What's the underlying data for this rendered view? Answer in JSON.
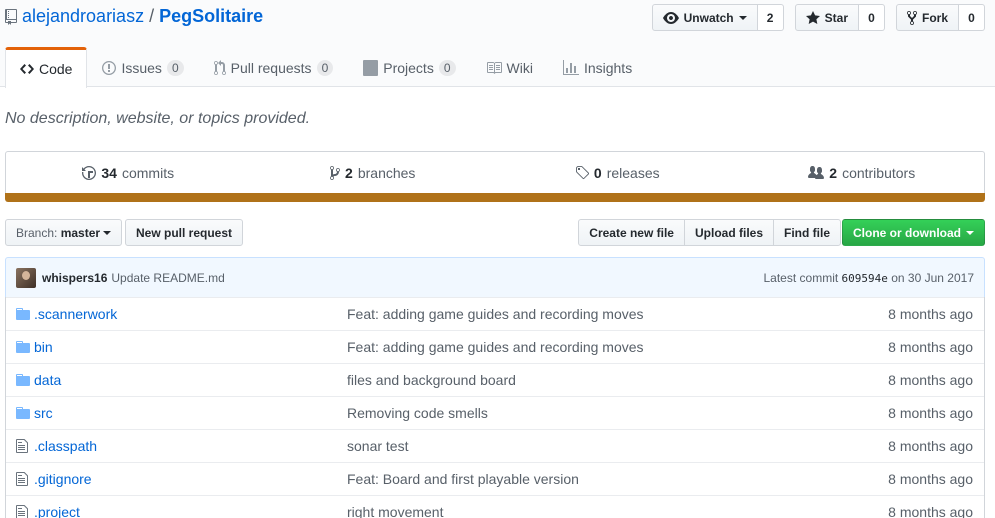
{
  "repo": {
    "owner": "alejandroariasz",
    "separator": "/",
    "name": "PegSolitaire"
  },
  "actions": {
    "watch_label": "Unwatch",
    "watch_count": "2",
    "star_label": "Star",
    "star_count": "0",
    "fork_label": "Fork",
    "fork_count": "0"
  },
  "tabs": [
    {
      "label": "Code",
      "icon": "code-icon"
    },
    {
      "label": "Issues",
      "count": "0",
      "icon": "issue-opened-icon"
    },
    {
      "label": "Pull requests",
      "count": "0",
      "icon": "git-pull-request-icon"
    },
    {
      "label": "Projects",
      "count": "0",
      "icon": "project-icon"
    },
    {
      "label": "Wiki",
      "icon": "book-icon"
    },
    {
      "label": "Insights",
      "icon": "graph-icon"
    }
  ],
  "description": "No description, website, or topics provided.",
  "summary": {
    "commits_num": "34",
    "commits_label": "commits",
    "branches_num": "2",
    "branches_label": "branches",
    "releases_num": "0",
    "releases_label": "releases",
    "contributors_num": "2",
    "contributors_label": "contributors"
  },
  "language_color": "#b07219",
  "file_nav": {
    "branch_prefix": "Branch:",
    "branch_name": "master",
    "new_pr": "New pull request",
    "create_file": "Create new file",
    "upload_files": "Upload files",
    "find_file": "Find file",
    "clone": "Clone or download"
  },
  "latest_commit": {
    "author": "whispers16",
    "message": "Update README.md",
    "prefix": "Latest commit",
    "sha": "609594e",
    "date": "on 30 Jun 2017"
  },
  "files": [
    {
      "type": "dir",
      "name": ".scannerwork",
      "message": "Feat: adding game guides and recording moves",
      "age": "8 months ago"
    },
    {
      "type": "dir",
      "name": "bin",
      "message": "Feat: adding game guides and recording moves",
      "age": "8 months ago"
    },
    {
      "type": "dir",
      "name": "data",
      "message": "files and background board",
      "age": "8 months ago"
    },
    {
      "type": "dir",
      "name": "src",
      "message": "Removing code smells",
      "age": "8 months ago"
    },
    {
      "type": "file",
      "name": ".classpath",
      "message": "sonar test",
      "age": "8 months ago"
    },
    {
      "type": "file",
      "name": ".gitignore",
      "message": "Feat: Board and first playable version",
      "age": "8 months ago"
    },
    {
      "type": "file",
      "name": ".project",
      "message": "right movement",
      "age": "8 months ago"
    }
  ]
}
